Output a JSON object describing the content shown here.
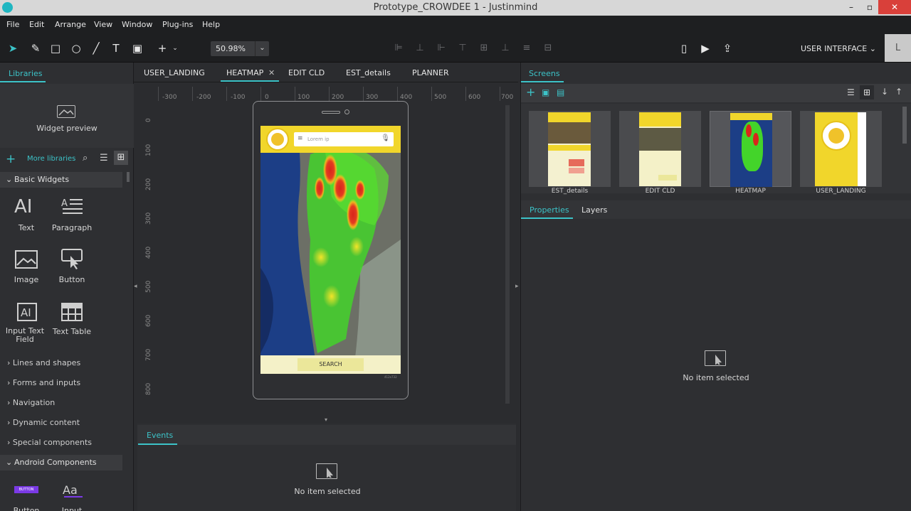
{
  "window": {
    "title": "Prototype_CROWDEE 1 - Justinmind",
    "controls": [
      "–",
      "▫",
      "✕"
    ]
  },
  "menu": [
    "File",
    "Edit",
    "Arrange",
    "View",
    "Window",
    "Plug-ins",
    "Help"
  ],
  "toolbar": {
    "zoom": "50.98%",
    "mode": "USER INTERFACE",
    "avatar": "L"
  },
  "libraries": {
    "tab": "Libraries",
    "widget_preview": "Widget preview",
    "more_libraries": "More libraries",
    "basic_section": "Basic Widgets",
    "widgets": [
      {
        "label": "Text",
        "icon": "text-ai-icon"
      },
      {
        "label": "Paragraph",
        "icon": "paragraph-icon"
      },
      {
        "label": "Image",
        "icon": "image-icon"
      },
      {
        "label": "Button",
        "icon": "button-icon"
      },
      {
        "label": "Input Text Field",
        "icon": "input-text-field-icon"
      },
      {
        "label": "Text Table",
        "icon": "table-icon"
      }
    ],
    "groups": [
      "Lines and shapes",
      "Forms and inputs",
      "Navigation",
      "Dynamic content",
      "Special components"
    ],
    "android_section": "Android Components",
    "android_widgets": [
      {
        "label": "Button",
        "preview": "BUTTON"
      },
      {
        "label": "Input",
        "preview": "Aa"
      }
    ]
  },
  "doc_tabs": [
    {
      "label": "USER_LANDING",
      "active": false
    },
    {
      "label": "HEATMAP",
      "active": true
    },
    {
      "label": "EDIT CLD",
      "active": false
    },
    {
      "label": "EST_details",
      "active": false
    },
    {
      "label": "PLANNER",
      "active": false
    }
  ],
  "ruler": {
    "top": [
      "-300",
      "-200",
      "-100",
      "0",
      "100",
      "200",
      "300",
      "400",
      "500",
      "600",
      "700"
    ],
    "left": [
      "0",
      "100",
      "200",
      "300",
      "400",
      "500",
      "600",
      "700",
      "800"
    ]
  },
  "phone": {
    "search_placeholder": "Lorem ip",
    "search_button": "SEARCH",
    "size_label": "412x732"
  },
  "events": {
    "tab": "Events",
    "empty": "No item selected"
  },
  "screens": {
    "tab": "Screens",
    "items": [
      {
        "label": "EST_details"
      },
      {
        "label": "EDIT CLD"
      },
      {
        "label": "HEATMAP"
      },
      {
        "label": "USER_LANDING"
      }
    ]
  },
  "properties": {
    "tab": "Properties",
    "layers_tab": "Layers",
    "empty": "No item selected"
  },
  "colors": {
    "accent": "#3cc3c8",
    "yellow": "#f1d62b",
    "heat_red": "#e0271c",
    "heat_green": "#3fd62a",
    "close": "#d9403a"
  }
}
